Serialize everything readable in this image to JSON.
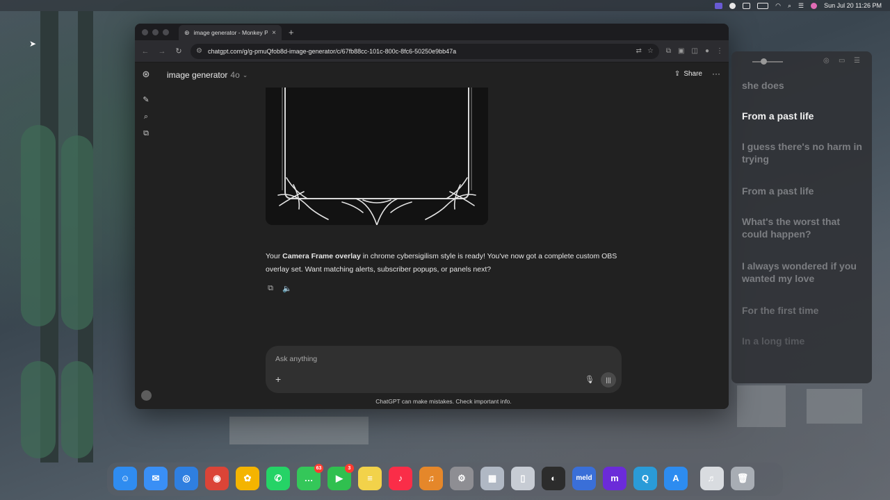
{
  "menubar": {
    "apple": "",
    "datetime": "Sun Jul 20  11:26 PM"
  },
  "browser": {
    "tab_title": "image generator - Monkey Pr",
    "tab_close": "×",
    "new_tab": "+",
    "url": "chatgpt.com/g/g-pmuQfob8d-image-generator/c/67fb88cc-101c-800c-8fc6-50250e9bb47a"
  },
  "chat": {
    "model_name": "image generator",
    "model_version": "4o",
    "share_label": "Share",
    "assistant_message": {
      "before": "Your ",
      "bold": "Camera Frame overlay",
      "after": " in chrome cybersigilism style is ready! You've now got a complete custom OBS overlay set. Want matching alerts, subscriber popups, or panels next?"
    },
    "composer_placeholder": "Ask anything",
    "disclaimer": "ChatGPT can make mistakes. Check important info."
  },
  "lyrics": {
    "lines": [
      {
        "text": "she does",
        "current": false
      },
      {
        "text": "From a past life",
        "current": true
      },
      {
        "text": "I guess there's no harm in trying",
        "current": false
      },
      {
        "text": "From a past life",
        "current": false
      },
      {
        "text": "What's the worst that could happen?",
        "current": false
      },
      {
        "text": "I always wondered if you wanted my love",
        "current": false
      },
      {
        "text": "For the first time",
        "current": false
      },
      {
        "text": "In a long time",
        "current": false
      }
    ]
  },
  "dock": {
    "apps": [
      {
        "name": "finder-icon",
        "color": "#2f8cf0",
        "glyph": "☺"
      },
      {
        "name": "mail-icon",
        "color": "#3a8ff5",
        "glyph": "✉"
      },
      {
        "name": "safari-icon",
        "color": "#2f7fe0",
        "glyph": "◎"
      },
      {
        "name": "chrome-icon",
        "color": "#db4437",
        "glyph": "◉"
      },
      {
        "name": "photos-icon",
        "color": "#f4b400",
        "glyph": "✿"
      },
      {
        "name": "whatsapp-icon",
        "color": "#25d366",
        "glyph": "✆"
      },
      {
        "name": "messages-icon",
        "color": "#34c759",
        "glyph": "…",
        "badge": "63"
      },
      {
        "name": "facetime-icon",
        "color": "#30c04f",
        "glyph": "▶",
        "badge": "3"
      },
      {
        "name": "notes-icon",
        "color": "#f2d24a",
        "glyph": "≡"
      },
      {
        "name": "music-icon",
        "color": "#fa2d48",
        "glyph": "♪"
      },
      {
        "name": "garageband-icon",
        "color": "#e5872a",
        "glyph": "♫"
      },
      {
        "name": "system-settings-icon",
        "color": "#8e8e93",
        "glyph": "⚙"
      },
      {
        "name": "launchpad-icon",
        "color": "#b0b8c4",
        "glyph": "▦"
      },
      {
        "name": "iphone-mirroring-icon",
        "color": "#c7ccd4",
        "glyph": "▯"
      },
      {
        "name": "obs-icon",
        "color": "#2c2c2c",
        "glyph": "◐"
      },
      {
        "name": "meld-icon",
        "color": "#3a6fd8",
        "glyph": "meld"
      },
      {
        "name": "m-app-icon",
        "color": "#6b2bd9",
        "glyph": "m"
      },
      {
        "name": "quicktime-icon",
        "color": "#2a9bd8",
        "glyph": "Q"
      },
      {
        "name": "app-store-icon",
        "color": "#2d8cf0",
        "glyph": "A"
      },
      {
        "name": "music-file-icon",
        "color": "#d9dce0",
        "glyph": "♬"
      },
      {
        "name": "trash-icon",
        "color": "#a8adb4",
        "glyph": "🗑"
      }
    ]
  }
}
